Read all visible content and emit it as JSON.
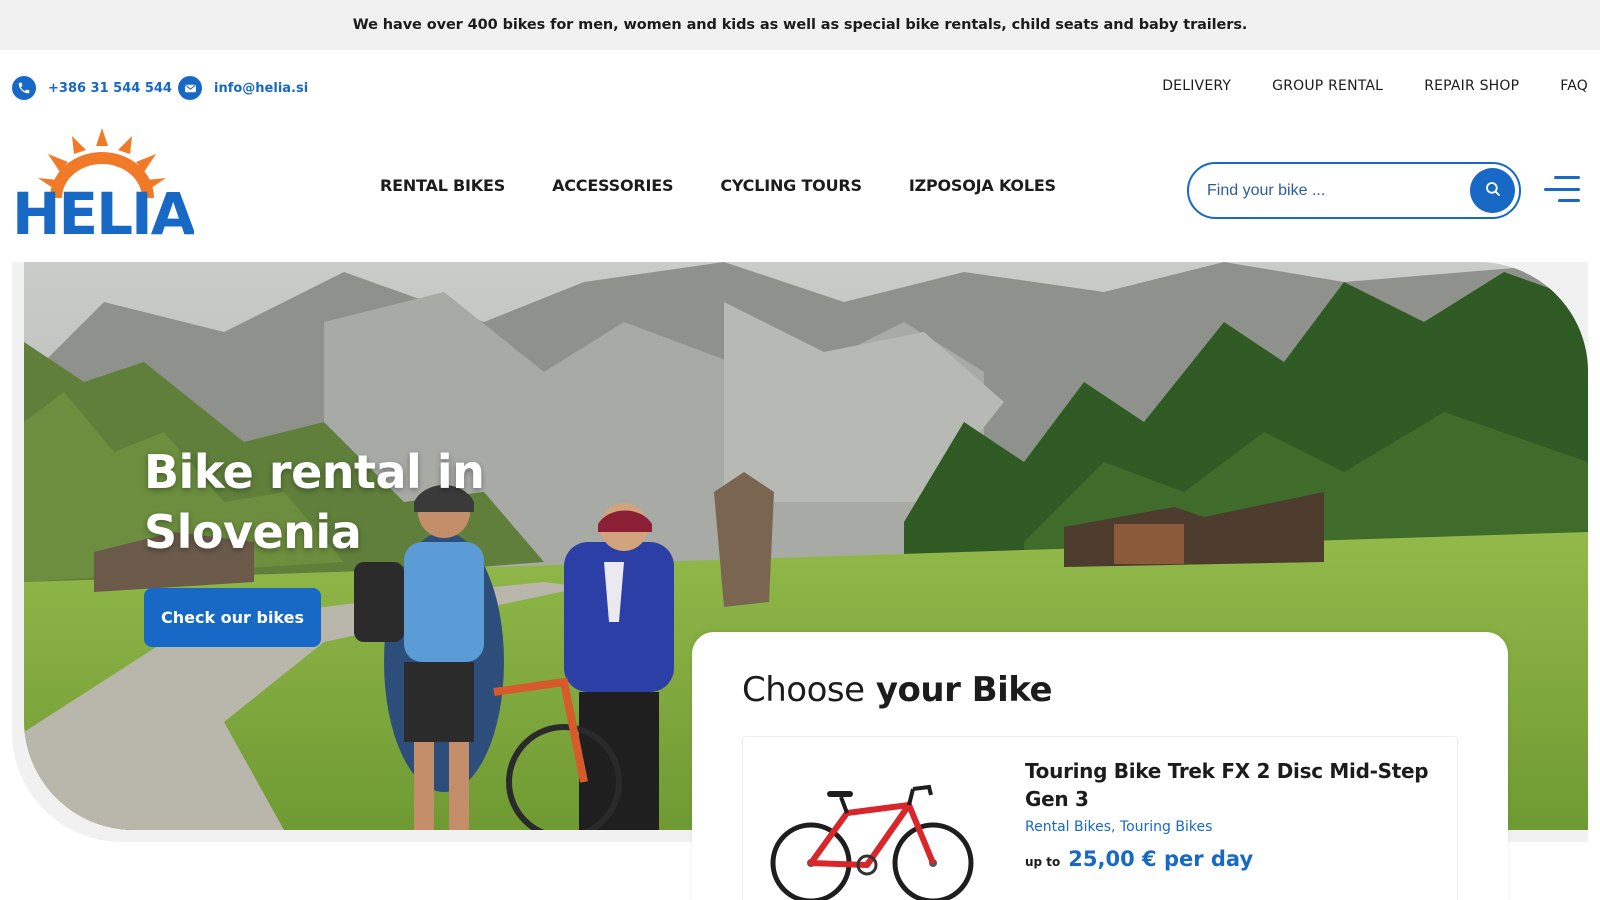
{
  "announcement": "We have over 400 bikes for men, women and kids as well as special bike rentals, child seats and baby trailers.",
  "contact": {
    "phone": "+386 31 544 544",
    "email": "info@helia.si"
  },
  "top_links": [
    "DELIVERY",
    "GROUP RENTAL",
    "REPAIR SHOP",
    "FAQ"
  ],
  "logo_text": "HELIA",
  "main_nav": [
    "RENTAL BIKES",
    "ACCESSORIES",
    "CYCLING TOURS",
    "IZPOSOJA KOLES"
  ],
  "search": {
    "placeholder": "Find your bike ..."
  },
  "hero": {
    "title_line1": "Bike rental in",
    "title_line2": "Slovenia",
    "cta_label": "Check our bikes"
  },
  "choose": {
    "title_light": "Choose",
    "title_bold": "your Bike",
    "products": [
      {
        "name": "Touring Bike Trek FX 2 Disc Mid-Step Gen 3",
        "categories": "Rental Bikes, Touring Bikes",
        "price_prefix": "up to",
        "price": "25,00 € per day"
      }
    ]
  },
  "colors": {
    "brand_blue": "#1769c5",
    "logo_orange": "#f07a28",
    "announcement_bg": "#f1f1f1",
    "bike_red": "#d9262b"
  },
  "icons": [
    "phone-icon",
    "mail-icon",
    "search-icon",
    "hamburger-menu-icon",
    "sun-logo-icon"
  ]
}
